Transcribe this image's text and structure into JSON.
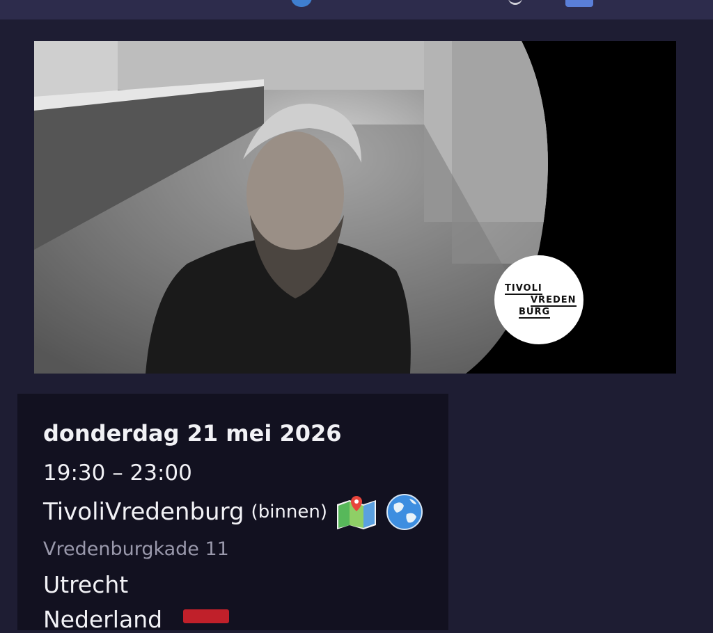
{
  "colors": {
    "background": "#1e1d33",
    "card": "#121120",
    "accent_topbar": "#2d2c4c"
  },
  "header": {
    "cut_title": "",
    "icons": [
      "globe-icon",
      "chevron-icon",
      "share-icon"
    ]
  },
  "banner": {
    "alt_icon": "artist-photo",
    "logo": {
      "line1": "TIVOLI",
      "line2": "VREDEN",
      "line3": "BURG"
    }
  },
  "event": {
    "date": "donderdag 21 mei 2026",
    "time": "19:30 – 23:00",
    "venue": "TivoliVredenburg",
    "venue_qualifier": "(binnen)",
    "street": "Vredenburgkade 11",
    "city": "Utrecht",
    "country": "Nederland",
    "map_icon": "map-icon",
    "website_icon": "globe-icon",
    "country_flag_icon": "flag-icon"
  }
}
